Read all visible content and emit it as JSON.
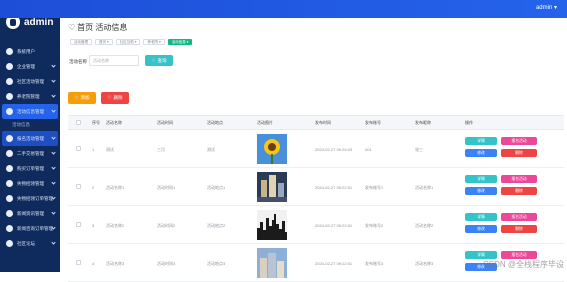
{
  "topbar": {
    "user": "admin ▾"
  },
  "sidebar": {
    "brand": "admin",
    "items": [
      {
        "label": "系统用户"
      },
      {
        "label": "企业管理"
      },
      {
        "label": "社区活动管理"
      },
      {
        "label": "养老院管理"
      },
      {
        "label": "活动信息管理",
        "sub": "活动信息"
      },
      {
        "label": "报名活动管理"
      },
      {
        "label": "二手交易管理"
      },
      {
        "label": "购买订单管理"
      },
      {
        "label": "失物招领管理"
      },
      {
        "label": "失物招领订单管理"
      },
      {
        "label": "新闻资讯管理"
      },
      {
        "label": "新闻咨询订单管理"
      },
      {
        "label": "社区论坛"
      }
    ]
  },
  "page": {
    "title": "首页  活动信息"
  },
  "breadcrumbs": [
    "活动管理",
    "首页 ▾",
    "社区互助 ▾",
    "养老院 ▾",
    "活动信息 ▾"
  ],
  "search": {
    "label": "活动名称",
    "placeholder": "活动名称",
    "button": "查询"
  },
  "toolbar": {
    "add": "添加",
    "delete": "删除"
  },
  "table": {
    "headers": [
      "序号",
      "活动名称",
      "活动时间",
      "活动地点",
      "活动图片",
      "发布时间",
      "发布账号",
      "发布昵称",
      "操作"
    ],
    "rows": [
      {
        "no": "1",
        "name": "测试",
        "time": "三月",
        "place": "测试",
        "published": "2024-02-27 09:29:03",
        "account": "001",
        "nickname": "张三",
        "image": "sunflower"
      },
      {
        "no": "2",
        "name": "活动名称1",
        "time": "活动时间1",
        "place": "活动地点1",
        "published": "2024-02-27 09:22:01",
        "account": "发布账号1",
        "nickname": "活动名称1",
        "image": "city"
      },
      {
        "no": "3",
        "name": "活动名称2",
        "time": "活动时间2",
        "place": "活动地点2",
        "published": "2024-02-27 09:22:01",
        "account": "发布账号2",
        "nickname": "活动名称2",
        "image": "skyline"
      },
      {
        "no": "4",
        "name": "活动名称3",
        "time": "活动时间3",
        "place": "活动地点3",
        "published": "2024-02-27 09:22:01",
        "account": "发布账号3",
        "nickname": "活动名称3",
        "image": "buildings"
      }
    ],
    "actions": {
      "detail": "详情",
      "signup": "报名活动",
      "edit": "修改",
      "delete": "删除"
    }
  },
  "watermark": "CSDN @全栈程序毕设",
  "colors": {
    "sidebar": "#0f2a5c",
    "primary": "#2563eb",
    "teal": "#34c3c9",
    "orange": "#f59e0b",
    "red": "#ef4444",
    "pink": "#ec4899",
    "blue": "#3b82f6"
  }
}
